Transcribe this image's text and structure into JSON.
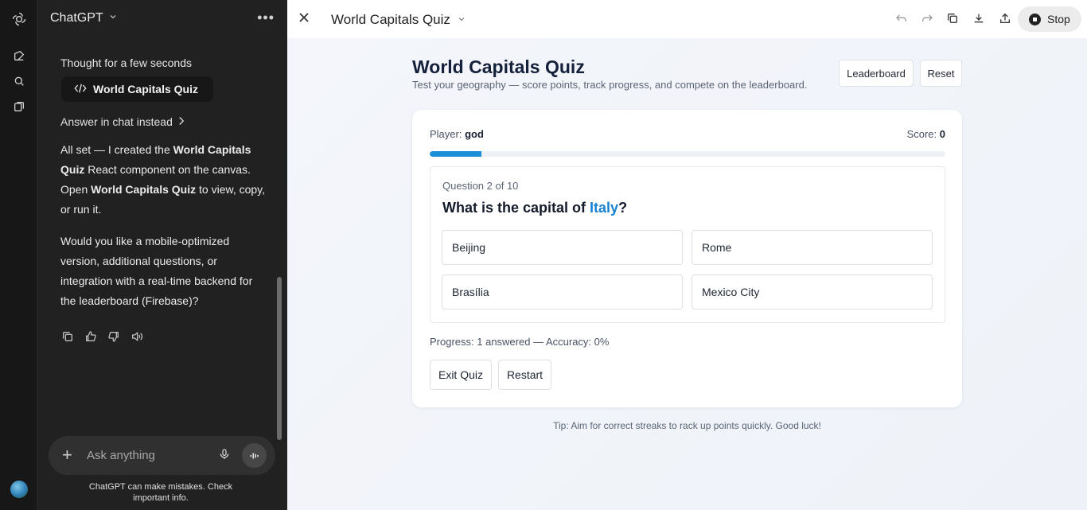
{
  "sidebar": {
    "app_name": "ChatGPT",
    "thought_label": "Thought for a few seconds",
    "artifact_label": "World Capitals Quiz",
    "answer_link": "Answer in chat instead",
    "message_p1_a": "All set — I created the ",
    "message_p1_b": "World Capitals Quiz",
    "message_p1_c": " React component on the canvas. Open ",
    "message_p1_d": "World Capitals Quiz",
    "message_p1_e": " to view, copy, or run it.",
    "message_p2": "Would you like a mobile-optimized version, additional questions, or integration with a real-time backend for the leaderboard (Firebase)?",
    "composer_placeholder": "Ask anything",
    "disclaimer": "ChatGPT can make mistakes. Check important info."
  },
  "canvas": {
    "doc_title": "World Capitals Quiz",
    "stop_label": "Stop"
  },
  "quiz": {
    "title": "World Capitals Quiz",
    "subtitle": "Test your geography — score points, track progress, and compete on the leaderboard.",
    "leaderboard_label": "Leaderboard",
    "reset_label": "Reset",
    "player_label": "Player:",
    "player_name": "god",
    "score_label": "Score:",
    "score_value": "0",
    "progress_fraction": 0.1,
    "question_number": "Question 2 of 10",
    "question_prefix": "What is the capital of ",
    "question_country": "Italy",
    "question_suffix": "?",
    "options": [
      "Beijing",
      "Rome",
      "Brasília",
      "Mexico City"
    ],
    "stats": "Progress: 1 answered — Accuracy: 0%",
    "exit_label": "Exit Quiz",
    "restart_label": "Restart",
    "tip": "Tip: Aim for correct streaks to rack up points quickly. Good luck!"
  },
  "colors": {
    "accent": "#1a8fd8",
    "country_highlight": "#1a82d2",
    "sidebar_bg": "#212121"
  }
}
